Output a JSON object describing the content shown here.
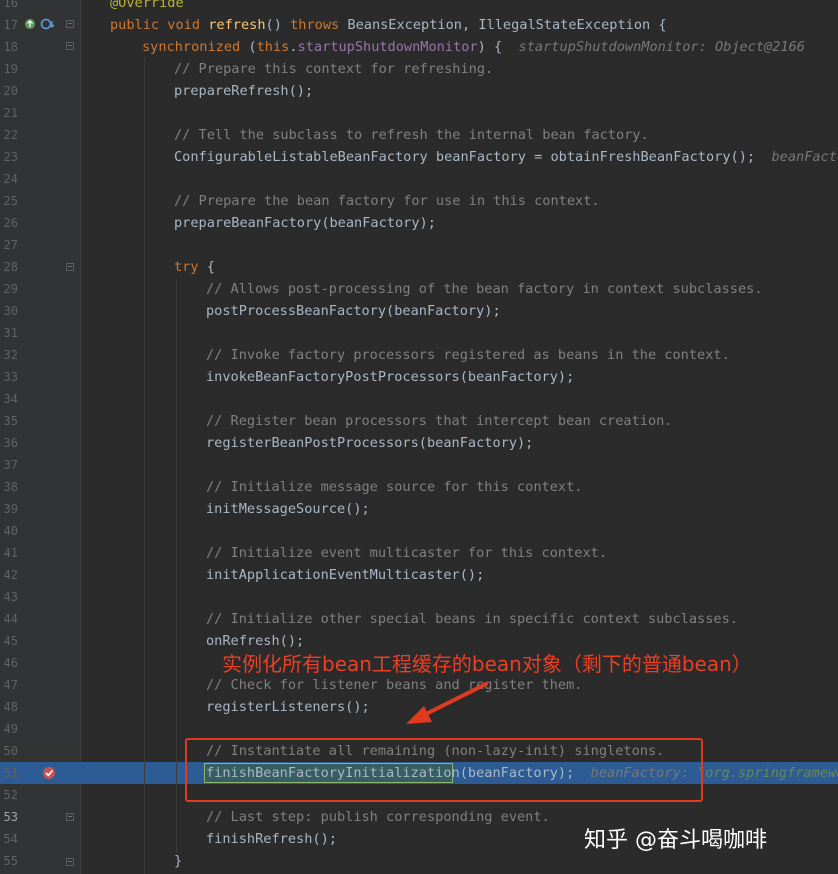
{
  "gutter": {
    "line_numbers": [
      "16",
      "17",
      "18",
      "19",
      "20",
      "21",
      "22",
      "23",
      "24",
      "25",
      "26",
      "27",
      "28",
      "29",
      "30",
      "31",
      "32",
      "33",
      "34",
      "35",
      "36",
      "37",
      "38",
      "39",
      "40",
      "41",
      "42",
      "43",
      "44",
      "45",
      "46",
      "47",
      "48",
      "49",
      "50",
      "51",
      "52",
      "53",
      "54",
      "55"
    ],
    "current_line": "53",
    "breakpoint_line": "51"
  },
  "code": {
    "l0_annotation": "@Override",
    "l1_public": "public",
    "l1_void": "void",
    "l1_method": "refresh",
    "l1_paren": "() ",
    "l1_throws": "throws",
    "l1_rest": " BeansException, IllegalStateException {",
    "l2_sync": "synchronized",
    "l2_open": " (",
    "l2_this": "this",
    "l2_dot": ".",
    "l2_field": "startupShutdownMonitor",
    "l2_close": ") {",
    "l2_hint": "startupShutdownMonitor: Object@2166",
    "l3": "// Prepare this context for refreshing.",
    "l4_call": "prepareRefresh();",
    "l6": "// Tell the subclass to refresh the internal bean factory.",
    "l7_code": "ConfigurableListableBeanFactory beanFactory = obtainFreshBeanFactory();",
    "l7_hint": "beanFactor",
    "l9": "// Prepare the bean factory for use in this context.",
    "l10": "prepareBeanFactory(beanFactory);",
    "l12_try": "try",
    "l12_brace": " {",
    "l13": "// Allows post-processing of the bean factory in context subclasses.",
    "l14": "postProcessBeanFactory(beanFactory);",
    "l16": "// Invoke factory processors registered as beans in the context.",
    "l17": "invokeBeanFactoryPostProcessors(beanFactory);",
    "l19": "// Register bean processors that intercept bean creation.",
    "l20": "registerBeanPostProcessors(beanFactory);",
    "l22": "// Initialize message source for this context.",
    "l23": "initMessageSource();",
    "l25": "// Initialize event multicaster for this context.",
    "l26": "initApplicationEventMulticaster();",
    "l28": "// Initialize other special beans in specific context subclasses.",
    "l29": "onRefresh();",
    "l31": "// Check for listener beans and register them.",
    "l32": "registerListeners();",
    "l34": "// Instantiate all remaining (non-lazy-init) singletons.",
    "l35_sel": "finishBeanFactoryInitialization",
    "l35_rest": "(beanFactory);",
    "l35_hint_key": "beanFactory: ",
    "l35_hint_val": "\"org.springframewor",
    "l37": "// Last step: publish corresponding event.",
    "l38": "finishRefresh();",
    "l39": "}"
  },
  "annotation_text": "实例化所有bean工程缓存的bean对象（剩下的普通bean）",
  "watermark": "知乎 @奋斗喝咖啡",
  "colors": {
    "background": "#2b2b2b",
    "keyword": "#cc7832",
    "comment": "#808080",
    "annotation_red": "#ee3e24",
    "execution_line": "#2d5c94"
  },
  "icons": [
    "override-icon",
    "implemented-icon",
    "breakpoint-check-icon",
    "fold-marker-icon"
  ]
}
